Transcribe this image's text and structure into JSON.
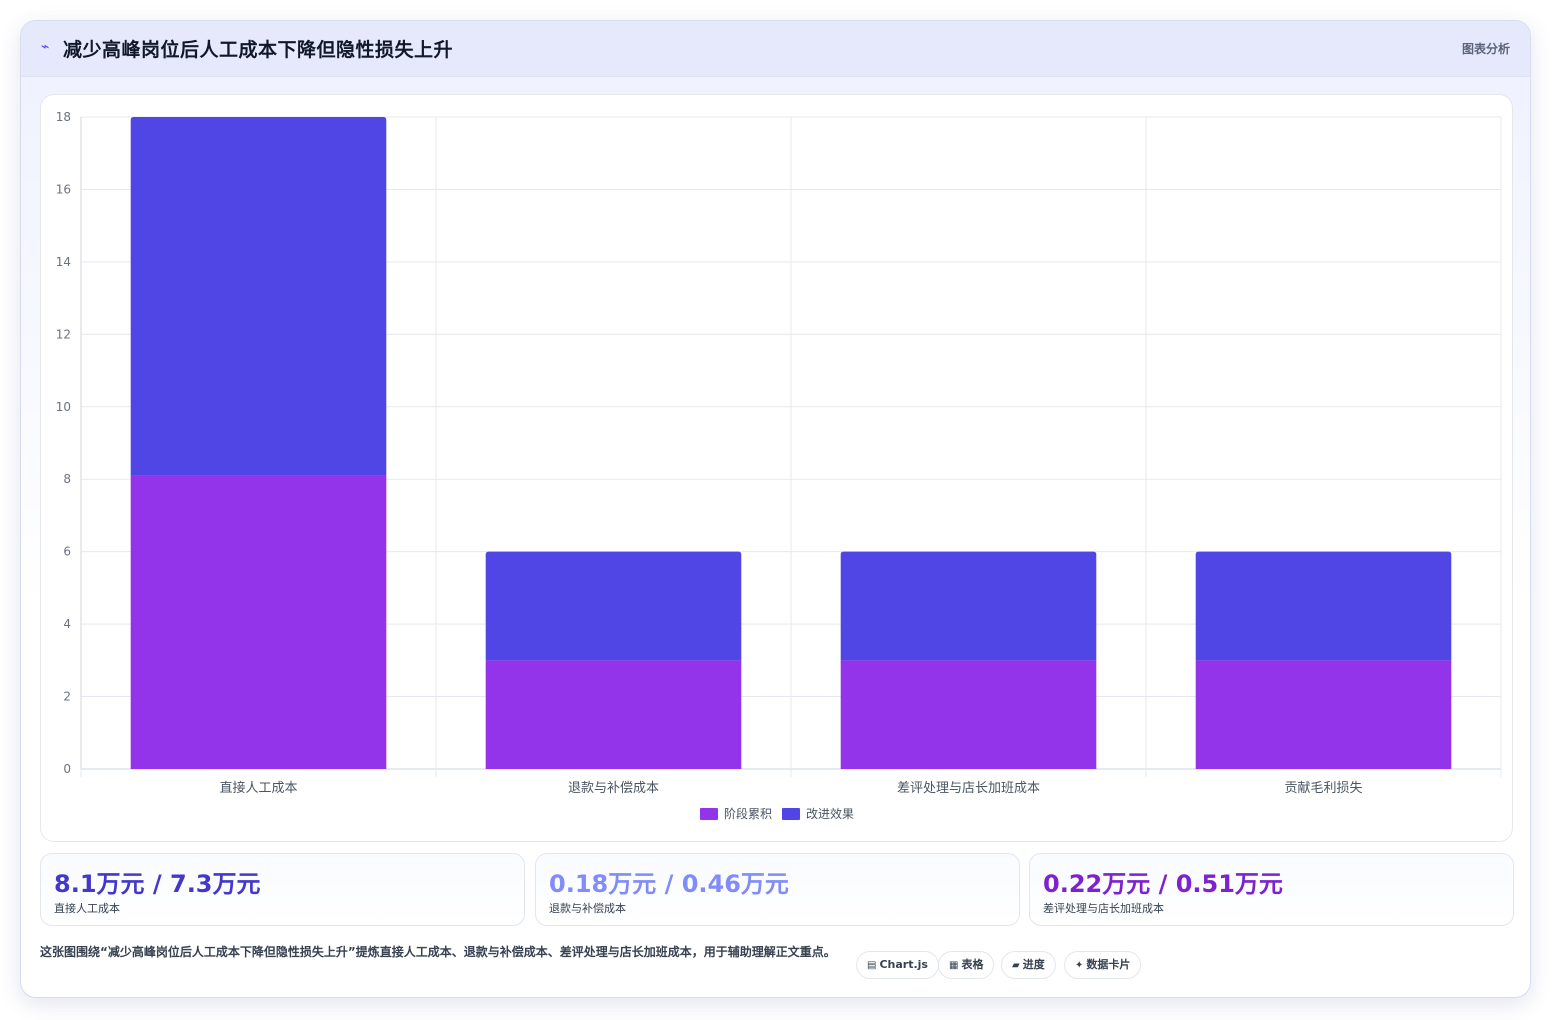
{
  "header": {
    "title_icon": "chart-icon",
    "title": "减少高峰岗位后人工成本下降但隐性损失上升",
    "badge": "图表分析"
  },
  "chart_data": {
    "type": "bar",
    "stacked": true,
    "categories": [
      "直接人工成本",
      "退款与补偿成本",
      "差评处理与店长加班成本",
      "贡献毛利损失"
    ],
    "series": [
      {
        "name": "阶段累积",
        "color": "#9333ea",
        "values": [
          8.1,
          3,
          3,
          3
        ]
      },
      {
        "name": "改进效果",
        "color": "#4f46e5",
        "values": [
          9.9,
          3,
          3,
          3
        ]
      }
    ],
    "ylim": [
      0,
      18
    ],
    "yticks": [
      0,
      2,
      4,
      6,
      8,
      10,
      12,
      14,
      16,
      18
    ],
    "grid": true,
    "legend_position": "bottom"
  },
  "stats": [
    {
      "value": "8.1万元 / 7.3万元",
      "label": "直接人工成本",
      "color": "#4338ca"
    },
    {
      "value": "0.18万元 / 0.46万元",
      "label": "退款与补偿成本",
      "color": "#818cf8"
    },
    {
      "value": "0.22万元 / 0.51万元",
      "label": "差评处理与店长加班成本",
      "color": "#7e22ce"
    }
  ],
  "description": "这张图围绕“减少高峰岗位后人工成本下降但隐性损失上升”提炼直接人工成本、退款与补偿成本、差评处理与店长加班成本，用于辅助理解正文重点。",
  "chips": [
    {
      "icon": "image-icon",
      "glyph": "▤",
      "label": "Chart.js"
    },
    {
      "icon": "table-icon",
      "glyph": "▦",
      "label": "表格"
    },
    {
      "icon": "progress-icon",
      "glyph": "▰",
      "label": "进度"
    },
    {
      "icon": "sparkle-icon",
      "glyph": "✦",
      "label": "数据卡片"
    }
  ]
}
